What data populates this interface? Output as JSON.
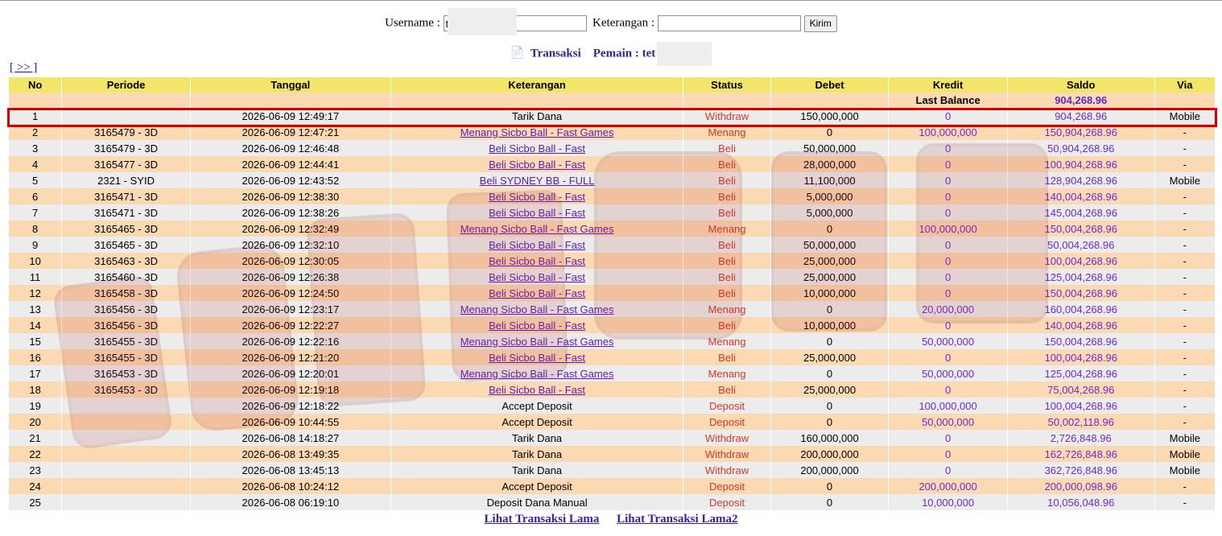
{
  "form": {
    "username_label": "Username :",
    "username_value": "t",
    "keterangan_label": "Keterangan :",
    "keterangan_value": "",
    "submit_label": "Kirim"
  },
  "title": {
    "transaksi": "Transaksi",
    "pemain_label": "Pemain : tet"
  },
  "nav_next": "[ >> ]",
  "columns": [
    "No",
    "Periode",
    "Tanggal",
    "Keterangan",
    "Status",
    "Debet",
    "Kredit",
    "Saldo",
    "Via"
  ],
  "last_balance": {
    "label": "Last Balance",
    "value": "904,268.96"
  },
  "rows": [
    {
      "no": "1",
      "periode": "",
      "tanggal": "2026-06-09 12:49:17",
      "keterangan": "Tarik Dana",
      "link": false,
      "status": "Withdraw",
      "debet": "150,000,000",
      "kredit": "0",
      "saldo": "904,268.96",
      "via": "Mobile"
    },
    {
      "no": "2",
      "periode": "3165479 - 3D",
      "tanggal": "2026-06-09 12:47:21",
      "keterangan": "Menang Sicbo Ball - Fast Games",
      "link": true,
      "status": "Menang",
      "debet": "0",
      "kredit": "100,000,000",
      "saldo": "150,904,268.96",
      "via": "-"
    },
    {
      "no": "3",
      "periode": "3165479 - 3D",
      "tanggal": "2026-06-09 12:46:48",
      "keterangan": "Beli Sicbo Ball - Fast",
      "link": true,
      "status": "Beli",
      "debet": "50,000,000",
      "kredit": "0",
      "saldo": "50,904,268.96",
      "via": "-"
    },
    {
      "no": "4",
      "periode": "3165477 - 3D",
      "tanggal": "2026-06-09 12:44:41",
      "keterangan": "Beli Sicbo Ball - Fast",
      "link": true,
      "status": "Beli",
      "debet": "28,000,000",
      "kredit": "0",
      "saldo": "100,904,268.96",
      "via": "-"
    },
    {
      "no": "5",
      "periode": "2321 - SYID",
      "tanggal": "2026-06-09 12:43:52",
      "keterangan": "Beli SYDNEY BB - FULL",
      "link": true,
      "status": "Beli",
      "debet": "11,100,000",
      "kredit": "0",
      "saldo": "128,904,268.96",
      "via": "Mobile"
    },
    {
      "no": "6",
      "periode": "3165471 - 3D",
      "tanggal": "2026-06-09 12:38:30",
      "keterangan": "Beli Sicbo Ball - Fast",
      "link": true,
      "status": "Beli",
      "debet": "5,000,000",
      "kredit": "0",
      "saldo": "140,004,268.96",
      "via": "-"
    },
    {
      "no": "7",
      "periode": "3165471 - 3D",
      "tanggal": "2026-06-09 12:38:26",
      "keterangan": "Beli Sicbo Ball - Fast",
      "link": true,
      "status": "Beli",
      "debet": "5,000,000",
      "kredit": "0",
      "saldo": "145,004,268.96",
      "via": "-"
    },
    {
      "no": "8",
      "periode": "3165465 - 3D",
      "tanggal": "2026-06-09 12:32:49",
      "keterangan": "Menang Sicbo Ball - Fast Games",
      "link": true,
      "status": "Menang",
      "debet": "0",
      "kredit": "100,000,000",
      "saldo": "150,004,268.96",
      "via": "-"
    },
    {
      "no": "9",
      "periode": "3165465 - 3D",
      "tanggal": "2026-06-09 12:32:10",
      "keterangan": "Beli Sicbo Ball - Fast",
      "link": true,
      "status": "Beli",
      "debet": "50,000,000",
      "kredit": "0",
      "saldo": "50,004,268.96",
      "via": "-"
    },
    {
      "no": "10",
      "periode": "3165463 - 3D",
      "tanggal": "2026-06-09 12:30:05",
      "keterangan": "Beli Sicbo Ball - Fast",
      "link": true,
      "status": "Beli",
      "debet": "25,000,000",
      "kredit": "0",
      "saldo": "100,004,268.96",
      "via": "-"
    },
    {
      "no": "11",
      "periode": "3165460 - 3D",
      "tanggal": "2026-06-09 12:26:38",
      "keterangan": "Beli Sicbo Ball - Fast",
      "link": true,
      "status": "Beli",
      "debet": "25,000,000",
      "kredit": "0",
      "saldo": "125,004,268.96",
      "via": "-"
    },
    {
      "no": "12",
      "periode": "3165458 - 3D",
      "tanggal": "2026-06-09 12:24:50",
      "keterangan": "Beli Sicbo Ball - Fast",
      "link": true,
      "status": "Beli",
      "debet": "10,000,000",
      "kredit": "0",
      "saldo": "150,004,268.96",
      "via": "-"
    },
    {
      "no": "13",
      "periode": "3165456 - 3D",
      "tanggal": "2026-06-09 12:23:17",
      "keterangan": "Menang Sicbo Ball - Fast Games",
      "link": true,
      "status": "Menang",
      "debet": "0",
      "kredit": "20,000,000",
      "saldo": "160,004,268.96",
      "via": "-"
    },
    {
      "no": "14",
      "periode": "3165456 - 3D",
      "tanggal": "2026-06-09 12:22:27",
      "keterangan": "Beli Sicbo Ball - Fast",
      "link": true,
      "status": "Beli",
      "debet": "10,000,000",
      "kredit": "0",
      "saldo": "140,004,268.96",
      "via": "-"
    },
    {
      "no": "15",
      "periode": "3165455 - 3D",
      "tanggal": "2026-06-09 12:22:16",
      "keterangan": "Menang Sicbo Ball - Fast Games",
      "link": true,
      "status": "Menang",
      "debet": "0",
      "kredit": "50,000,000",
      "saldo": "150,004,268.96",
      "via": "-"
    },
    {
      "no": "16",
      "periode": "3165455 - 3D",
      "tanggal": "2026-06-09 12:21:20",
      "keterangan": "Beli Sicbo Ball - Fast",
      "link": true,
      "status": "Beli",
      "debet": "25,000,000",
      "kredit": "0",
      "saldo": "100,004,268.96",
      "via": "-"
    },
    {
      "no": "17",
      "periode": "3165453 - 3D",
      "tanggal": "2026-06-09 12:20:01",
      "keterangan": "Menang Sicbo Ball - Fast Games",
      "link": true,
      "status": "Menang",
      "debet": "0",
      "kredit": "50,000,000",
      "saldo": "125,004,268.96",
      "via": "-"
    },
    {
      "no": "18",
      "periode": "3165453 - 3D",
      "tanggal": "2026-06-09 12:19:18",
      "keterangan": "Beli Sicbo Ball - Fast",
      "link": true,
      "status": "Beli",
      "debet": "25,000,000",
      "kredit": "0",
      "saldo": "75,004,268.96",
      "via": "-"
    },
    {
      "no": "19",
      "periode": "",
      "tanggal": "2026-06-09 12:18:22",
      "keterangan": "Accept Deposit",
      "link": false,
      "status": "Deposit",
      "debet": "0",
      "kredit": "100,000,000",
      "saldo": "100,004,268.96",
      "via": "-"
    },
    {
      "no": "20",
      "periode": "",
      "tanggal": "2026-06-09 10:44:55",
      "keterangan": "Accept Deposit",
      "link": false,
      "status": "Deposit",
      "debet": "0",
      "kredit": "50,000,000",
      "saldo": "50,002,118.96",
      "via": "-"
    },
    {
      "no": "21",
      "periode": "",
      "tanggal": "2026-06-08 14:18:27",
      "keterangan": "Tarik Dana",
      "link": false,
      "status": "Withdraw",
      "debet": "160,000,000",
      "kredit": "0",
      "saldo": "2,726,848.96",
      "via": "Mobile"
    },
    {
      "no": "22",
      "periode": "",
      "tanggal": "2026-06-08 13:49:35",
      "keterangan": "Tarik Dana",
      "link": false,
      "status": "Withdraw",
      "debet": "200,000,000",
      "kredit": "0",
      "saldo": "162,726,848.96",
      "via": "Mobile"
    },
    {
      "no": "23",
      "periode": "",
      "tanggal": "2026-06-08 13:45:13",
      "keterangan": "Tarik Dana",
      "link": false,
      "status": "Withdraw",
      "debet": "200,000,000",
      "kredit": "0",
      "saldo": "362,726,848.96",
      "via": "Mobile"
    },
    {
      "no": "24",
      "periode": "",
      "tanggal": "2026-06-08 10:24:12",
      "keterangan": "Accept Deposit",
      "link": false,
      "status": "Deposit",
      "debet": "0",
      "kredit": "200,000,000",
      "saldo": "200,000,098.96",
      "via": "-"
    },
    {
      "no": "25",
      "periode": "",
      "tanggal": "2026-06-08 06:19:10",
      "keterangan": "Deposit Dana Manual",
      "link": false,
      "status": "Deposit",
      "debet": "0",
      "kredit": "10,000,000",
      "saldo": "10,056,048.96",
      "via": "-"
    }
  ],
  "footer_links": [
    "Lihat Transaksi Lama",
    "Lihat Transaksi Lama2"
  ],
  "colors": {
    "header_bg": "#f3e46a",
    "row_gray": "#ececec",
    "row_peach": "#fbd9b2",
    "status_red": "#d23a2a",
    "value_purple": "#6a2cd0",
    "highlight_red": "#d40000"
  }
}
